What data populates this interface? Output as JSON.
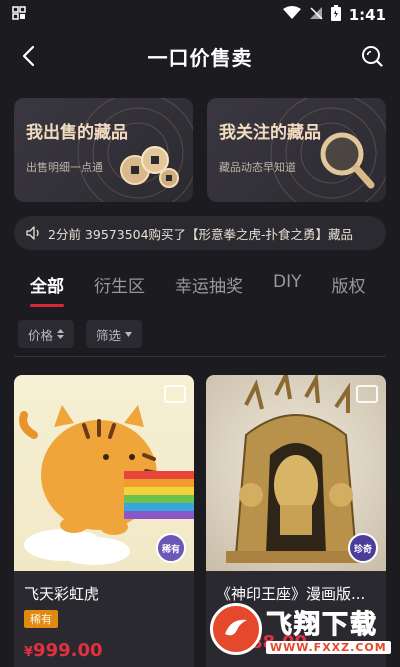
{
  "status_bar": {
    "time": "1:41",
    "left_icon": "app-grid-icon"
  },
  "nav": {
    "title": "一口价售卖",
    "back_icon": "chevron-left-icon",
    "search_icon": "search-icon"
  },
  "cards": [
    {
      "title": "我出售的藏品",
      "subtitle": "出售明细一点通",
      "icon": "coins-icon"
    },
    {
      "title": "我关注的藏品",
      "subtitle": "藏品动态早知道",
      "icon": "magnifier-icon"
    }
  ],
  "notice": {
    "icon": "speaker-icon",
    "text": "2分前 39573504购买了【形意拳之虎-扑食之勇】藏品"
  },
  "tabs": [
    "全部",
    "衍生区",
    "幸运抽奖",
    "DIY",
    "版权"
  ],
  "active_tab": 0,
  "filters": [
    {
      "label": "价格",
      "icon": "sort-icon"
    },
    {
      "label": "筛选",
      "icon": "caret-down-icon"
    }
  ],
  "products": [
    {
      "name": "飞天彩虹虎",
      "badge": "稀有",
      "rarity_mark": "稀有",
      "price_symbol": "¥",
      "price": "999.00"
    },
    {
      "name": "《神印王座》漫画版...",
      "badge": "",
      "rarity_mark": "珍奇",
      "price_symbol": "¥",
      "price": "4888.00"
    }
  ],
  "watermark": {
    "main": "飞翔下载",
    "sub": "WWW.FXXZ.COM"
  },
  "colors": {
    "accent": "#d8263a",
    "price": "#e23040",
    "card_title": "#f3dcc0",
    "badge": "#e08a12"
  }
}
